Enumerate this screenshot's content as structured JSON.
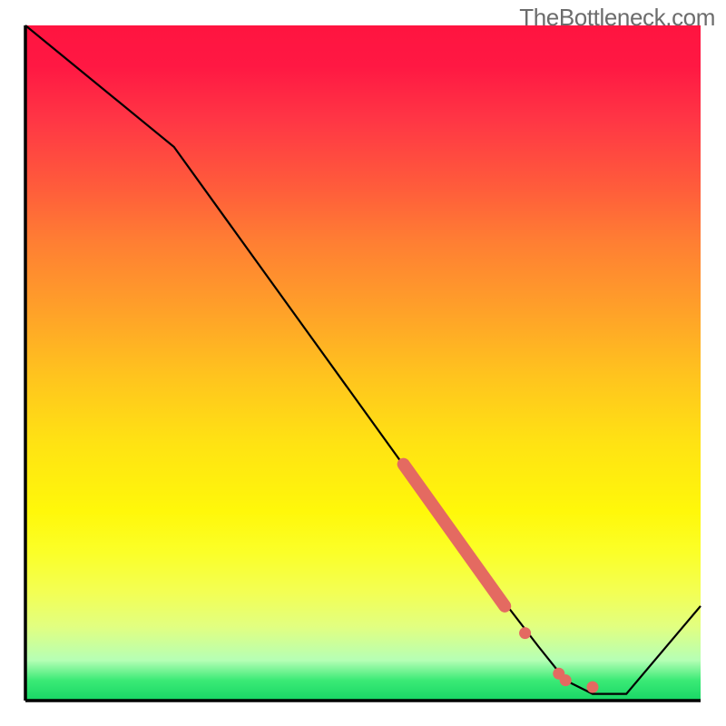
{
  "watermark": "TheBottleneck.com",
  "chart_data": {
    "type": "line",
    "title": "",
    "xlabel": "",
    "ylabel": "",
    "xlim": [
      0,
      100
    ],
    "ylim": [
      0,
      100
    ],
    "curve": [
      {
        "x": 0,
        "y": 100
      },
      {
        "x": 22,
        "y": 82
      },
      {
        "x": 66,
        "y": 21
      },
      {
        "x": 76,
        "y": 8
      },
      {
        "x": 80,
        "y": 3
      },
      {
        "x": 84,
        "y": 1
      },
      {
        "x": 89,
        "y": 1
      },
      {
        "x": 100,
        "y": 14
      }
    ],
    "highlight_segments": [
      {
        "x1": 56,
        "y1": 35,
        "x2": 71,
        "y2": 14
      }
    ],
    "highlight_points": [
      {
        "x": 74,
        "y": 10
      },
      {
        "x": 79,
        "y": 4
      },
      {
        "x": 80,
        "y": 3
      },
      {
        "x": 84,
        "y": 2
      }
    ],
    "background_gradient": {
      "top": "#ff1440",
      "mid_upper": "#ffa029",
      "mid": "#ffe313",
      "mid_lower": "#fbff28",
      "bottom": "#17d765"
    }
  }
}
